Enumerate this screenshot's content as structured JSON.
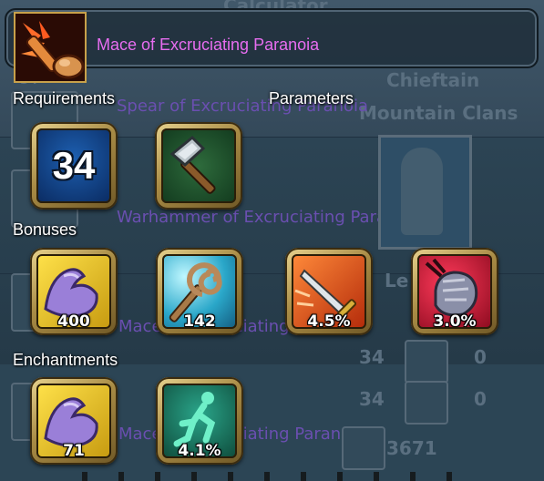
{
  "item": {
    "name": "Mace of Excruciating Paranoia",
    "name_color": "#e76df0"
  },
  "sections": {
    "requirements": "Requirements",
    "parameters": "Parameters",
    "bonuses": "Bonuses",
    "enchantments": "Enchantments"
  },
  "requirements": [
    {
      "icon": "level-icon",
      "value": "34"
    }
  ],
  "parameters": [
    {
      "icon": "warhammer-icon"
    }
  ],
  "bonuses": [
    {
      "icon": "strength-arm-icon",
      "value": "400"
    },
    {
      "icon": "swirl-staff-icon",
      "value": "142"
    },
    {
      "icon": "sword-strike-icon",
      "value": "4.5%"
    },
    {
      "icon": "crushing-fist-icon",
      "value": "3.0%"
    }
  ],
  "enchantments": [
    {
      "icon": "strength-arm-icon",
      "value": "71"
    },
    {
      "icon": "running-man-icon",
      "value": "4.1%"
    }
  ],
  "background": {
    "calculator": "Calculator",
    "chieftain": "Chieftain",
    "mountain_clans": "Mountain Clans",
    "spear": "Spear of Excruciating Paranoia",
    "warhammer": "Warhammer of Excruciating Paranoia",
    "mace_bonuses": "Mace of Excruciating Paranoia",
    "mace_enchant": "Mace of Excruciating Paranoia",
    "level_label": "Le",
    "row1_value": "34",
    "row1_zero": "0",
    "row2_value": "34",
    "row2_zero": "0",
    "bottom_value": "3671",
    "left_number": "34"
  }
}
